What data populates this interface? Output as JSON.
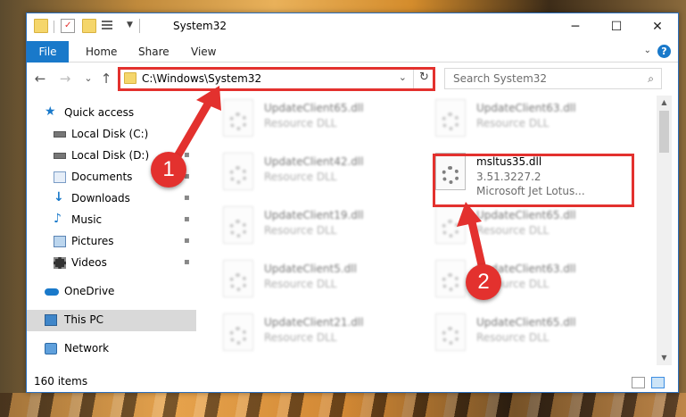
{
  "window": {
    "title": "System32",
    "controls": {
      "minimize": "─",
      "maximize": "☐",
      "close": "✕"
    }
  },
  "ribbon": {
    "tabs": [
      "File",
      "Home",
      "Share",
      "View"
    ],
    "help": "?",
    "collapse_chevron": "⌄"
  },
  "nav": {
    "back": "←",
    "forward": "→",
    "recent": "⌄",
    "up": "↑",
    "address": "C:\\Windows\\System32",
    "address_dropdown": "⌄",
    "refresh": "↻",
    "search_placeholder": "Search System32",
    "search_glyph": "⌕"
  },
  "sidebar": {
    "items": [
      {
        "label": "Quick access",
        "icon": "star-icon",
        "pinned": false
      },
      {
        "label": "Local Disk (C:)",
        "icon": "drive-icon",
        "pinned": false
      },
      {
        "label": "Local Disk (D:)",
        "icon": "drive-icon",
        "pinned": true
      },
      {
        "label": "Documents",
        "icon": "documents-icon",
        "pinned": true
      },
      {
        "label": "Downloads",
        "icon": "download-icon",
        "pinned": true
      },
      {
        "label": "Music",
        "icon": "music-icon",
        "pinned": true
      },
      {
        "label": "Pictures",
        "icon": "pictures-icon",
        "pinned": true
      },
      {
        "label": "Videos",
        "icon": "videos-icon",
        "pinned": true
      },
      {
        "label": "OneDrive",
        "icon": "cloud-icon",
        "pinned": false
      },
      {
        "label": "This PC",
        "icon": "computer-icon",
        "pinned": false,
        "selected": true
      },
      {
        "label": "Network",
        "icon": "network-icon",
        "pinned": false
      }
    ],
    "pin_glyph": "📌"
  },
  "files": [
    {
      "name": "UpdateClient65.dll",
      "line2": "Resource DLL",
      "line3": "",
      "blurred": true
    },
    {
      "name": "UpdateClient63.dll",
      "line2": "Resource DLL",
      "line3": "",
      "blurred": true
    },
    {
      "name": "UpdateClient42.dll",
      "line2": "Resource DLL",
      "line3": "",
      "blurred": true
    },
    {
      "name": "msltus35.dll",
      "line2": "3.51.3227.2",
      "line3": "Microsoft Jet Lotus...",
      "blurred": false
    },
    {
      "name": "UpdateClient19.dll",
      "line2": "Resource DLL",
      "line3": "",
      "blurred": true
    },
    {
      "name": "UpdateClient65.dll",
      "line2": "Resource DLL",
      "line3": "",
      "blurred": true
    },
    {
      "name": "UpdateClient5.dll",
      "line2": "Resource DLL",
      "line3": "",
      "blurred": true
    },
    {
      "name": "UpdateClient63.dll",
      "line2": "Resource DLL",
      "line3": "",
      "blurred": true
    },
    {
      "name": "UpdateClient21.dll",
      "line2": "Resource DLL",
      "line3": "",
      "blurred": true
    },
    {
      "name": "UpdateClient65.dll",
      "line2": "Resource DLL",
      "line3": "",
      "blurred": true
    }
  ],
  "status": {
    "item_count": "160 items"
  },
  "scrollbar": {
    "up": "▲",
    "down": "▼"
  },
  "callouts": [
    {
      "number": "1",
      "target": "address-bar"
    },
    {
      "number": "2",
      "target": "msltus35.dll"
    }
  ],
  "colors": {
    "accent": "#1979ca",
    "highlight": "#e3312e",
    "selected_row": "#d9d9d9"
  }
}
